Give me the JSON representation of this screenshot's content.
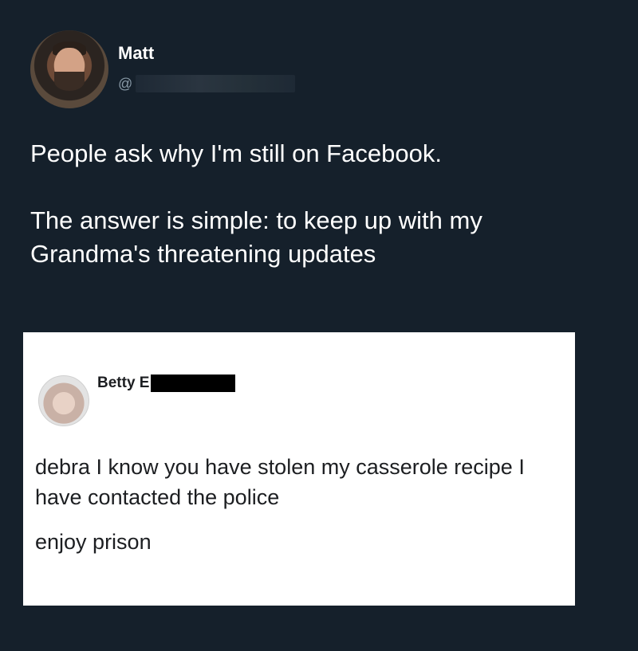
{
  "tweet": {
    "author": {
      "display_name": "Matt",
      "handle_prefix": "@",
      "avatar_icon": "profile-photo"
    },
    "text_paragraphs": [
      "People ask why I'm still on Facebook.",
      "The answer is simple: to keep up with my Grandma's threatening updates"
    ],
    "colors": {
      "background": "#15202b",
      "text": "#ffffff",
      "muted": "#8899a6"
    }
  },
  "embedded_post": {
    "author_name": "Betty E",
    "avatar_icon": "profile-photo",
    "paragraphs": [
      "debra I know you have stolen my casserole recipe I have contacted the police",
      "enjoy prison"
    ],
    "colors": {
      "background": "#ffffff",
      "text": "#1c1e21",
      "redaction": "#000000"
    }
  }
}
